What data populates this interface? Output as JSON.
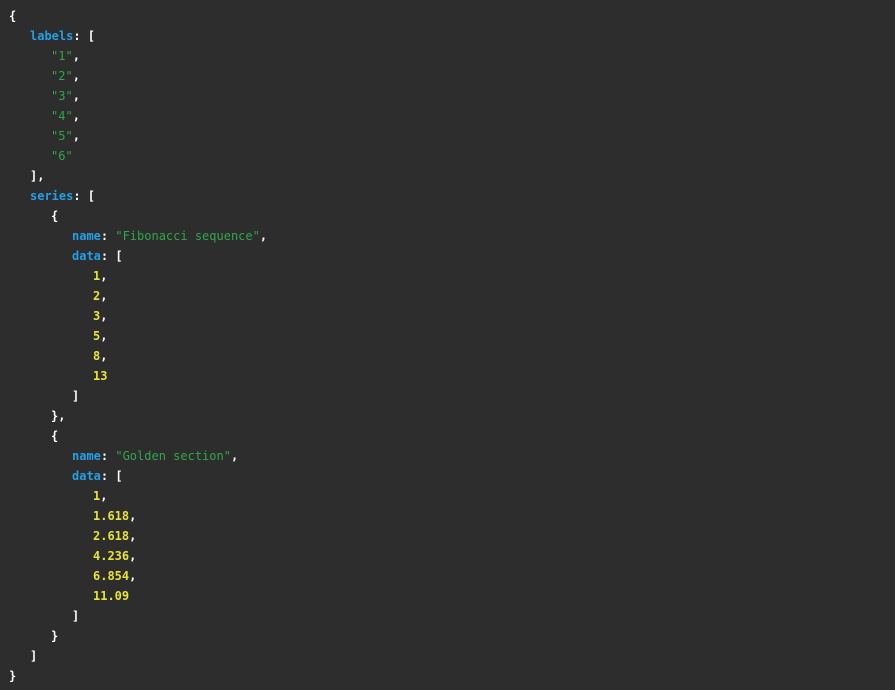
{
  "theme": {
    "background": "#2d2d2d",
    "punctuation": "#ffffff",
    "key": "#22a0e6",
    "string": "#31a64b",
    "number": "#e8e336"
  },
  "json": {
    "open_brace": "{",
    "close_brace": "}",
    "labels_key": "labels",
    "labels": [
      "\"1\"",
      "\"2\"",
      "\"3\"",
      "\"4\"",
      "\"5\"",
      "\"6\""
    ],
    "series_key": "series",
    "series": [
      {
        "name_key": "name",
        "name": "\"Fibonacci sequence\"",
        "data_key": "data",
        "data": [
          "1",
          "2",
          "3",
          "5",
          "8",
          "13"
        ]
      },
      {
        "name_key": "name",
        "name": "\"Golden section\"",
        "data_key": "data",
        "data": [
          "1",
          "1.618",
          "2.618",
          "4.236",
          "6.854",
          "11.09"
        ]
      }
    ]
  }
}
